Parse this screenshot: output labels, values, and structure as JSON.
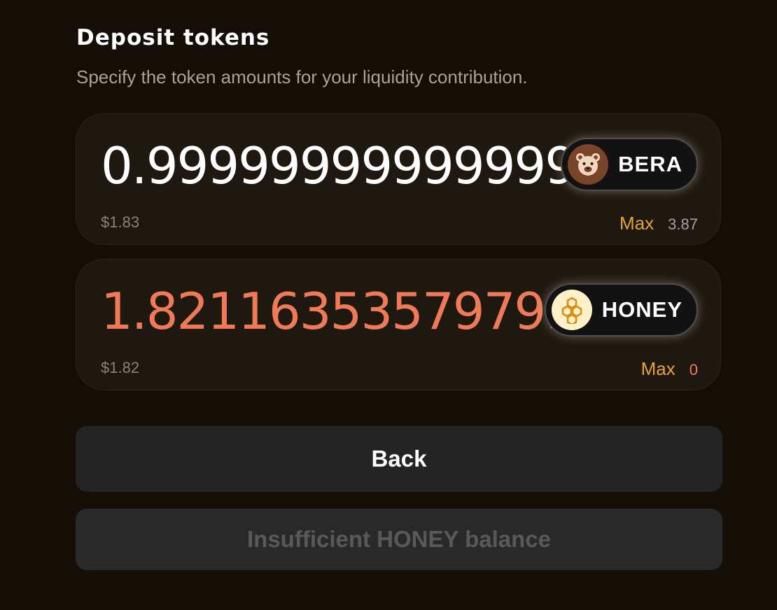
{
  "header": {
    "title": "Deposit tokens",
    "subtitle": "Specify the token amounts for your liquidity contribution."
  },
  "tokens": [
    {
      "amount": "0.99999999999999",
      "symbol": "BERA",
      "icon": "bear-icon",
      "usd_value": "$1.83",
      "max_label": "Max",
      "balance": "3.87"
    },
    {
      "amount": "1.821163535797994",
      "symbol": "HONEY",
      "icon": "honeycomb-icon",
      "usd_value": "$1.82",
      "max_label": "Max",
      "balance": "0"
    }
  ],
  "buttons": {
    "back_label": "Back",
    "submit_label": "Insufficient HONEY balance"
  },
  "colors": {
    "background": "#140e06",
    "card": "#1e1811",
    "accent_max": "#e2a33a",
    "error": "#f07a58",
    "bera_icon": "#7a4428",
    "honey_icon": "#fff0c8"
  }
}
